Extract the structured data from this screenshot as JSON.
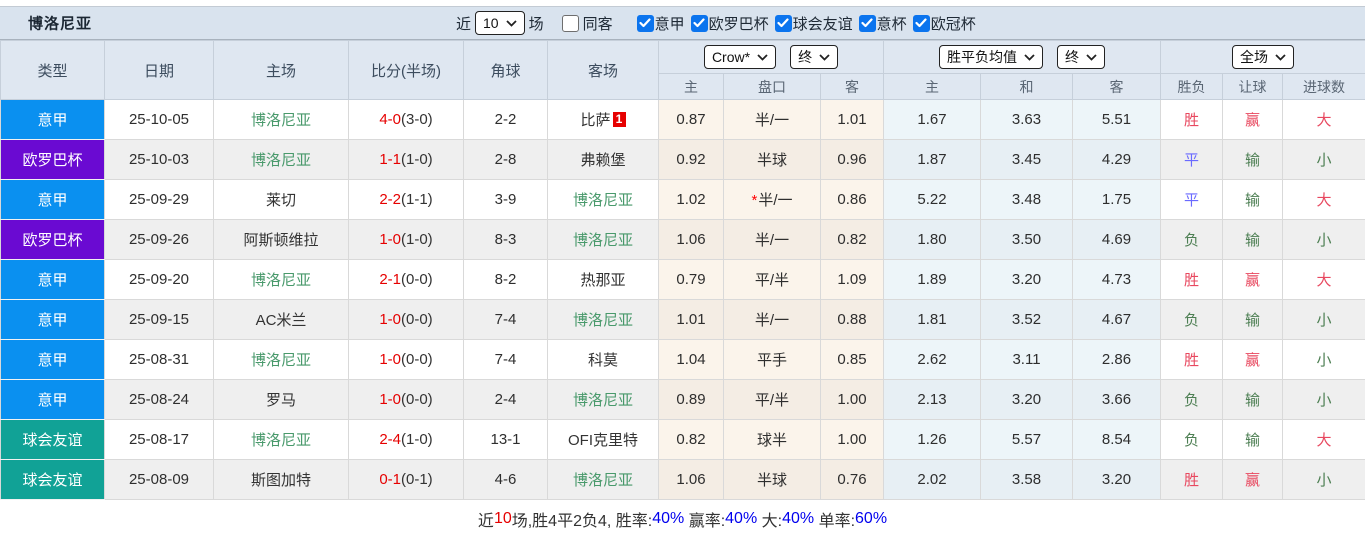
{
  "page_title": "博洛尼亚",
  "topbar": {
    "recent_label": "近",
    "recent_value": "10",
    "matches_label": "场",
    "same_away": {
      "label": "同客",
      "checked": false
    },
    "filters": [
      {
        "label": "意甲",
        "checked": true
      },
      {
        "label": "欧罗巴杯",
        "checked": true
      },
      {
        "label": "球会友谊",
        "checked": true
      },
      {
        "label": "意杯",
        "checked": true
      },
      {
        "label": "欧冠杯",
        "checked": true
      }
    ]
  },
  "header": {
    "columns": [
      "类型",
      "日期",
      "主场",
      "比分(半场)",
      "角球",
      "客场"
    ],
    "group_crow": {
      "company_select": "Crow*",
      "time_select": "终",
      "subcols": [
        "主",
        "盘口",
        "客"
      ]
    },
    "group_avg": {
      "company_select": "胜平负均值",
      "time_select": "终",
      "subcols": [
        "主",
        "和",
        "客"
      ]
    },
    "group_result": {
      "scope_select": "全场",
      "subcols": [
        "胜负",
        "让球",
        "进球数"
      ]
    }
  },
  "colors": {
    "league": {
      "意甲": "#0a90f0",
      "欧罗巴杯": "#6a0ad2",
      "球会友谊": "#11a296"
    },
    "result": {
      "胜": "#e8485f",
      "平": "#6a6aff",
      "负": "#4d7f53",
      "赢": "#e8485f",
      "输": "#4d7f53",
      "大": "#e8485f",
      "小": "#4d7f53"
    },
    "team_self": "#48996b",
    "team_other": "#333333",
    "score": "#e60000"
  },
  "rows": [
    {
      "league": "意甲",
      "date": "25-10-05",
      "home": "博洛尼亚",
      "home_self": true,
      "score": "4-0",
      "half_score": "(3-0)",
      "corners": "2-2",
      "away": "比萨",
      "away_self": false,
      "away_card": "1",
      "crow_home": "0.87",
      "handicap_star": "",
      "handicap": "半/一",
      "crow_away": "1.01",
      "avg_home": "1.67",
      "avg_draw": "3.63",
      "avg_away": "5.51",
      "result_wdl": "胜",
      "result_handicap": "赢",
      "result_goals": "大"
    },
    {
      "league": "欧罗巴杯",
      "date": "25-10-03",
      "home": "博洛尼亚",
      "home_self": true,
      "score": "1-1",
      "half_score": "(1-0)",
      "corners": "2-8",
      "away": "弗赖堡",
      "away_self": false,
      "away_card": "",
      "crow_home": "0.92",
      "handicap_star": "",
      "handicap": "半球",
      "crow_away": "0.96",
      "avg_home": "1.87",
      "avg_draw": "3.45",
      "avg_away": "4.29",
      "result_wdl": "平",
      "result_handicap": "输",
      "result_goals": "小"
    },
    {
      "league": "意甲",
      "date": "25-09-29",
      "home": "莱切",
      "home_self": false,
      "score": "2-2",
      "half_score": "(1-1)",
      "corners": "3-9",
      "away": "博洛尼亚",
      "away_self": true,
      "away_card": "",
      "crow_home": "1.02",
      "handicap_star": "*",
      "handicap": "半/一",
      "crow_away": "0.86",
      "avg_home": "5.22",
      "avg_draw": "3.48",
      "avg_away": "1.75",
      "result_wdl": "平",
      "result_handicap": "输",
      "result_goals": "大"
    },
    {
      "league": "欧罗巴杯",
      "date": "25-09-26",
      "home": "阿斯顿维拉",
      "home_self": false,
      "score": "1-0",
      "half_score": "(1-0)",
      "corners": "8-3",
      "away": "博洛尼亚",
      "away_self": true,
      "away_card": "",
      "crow_home": "1.06",
      "handicap_star": "",
      "handicap": "半/一",
      "crow_away": "0.82",
      "avg_home": "1.80",
      "avg_draw": "3.50",
      "avg_away": "4.69",
      "result_wdl": "负",
      "result_handicap": "输",
      "result_goals": "小"
    },
    {
      "league": "意甲",
      "date": "25-09-20",
      "home": "博洛尼亚",
      "home_self": true,
      "score": "2-1",
      "half_score": "(0-0)",
      "corners": "8-2",
      "away": "热那亚",
      "away_self": false,
      "away_card": "",
      "crow_home": "0.79",
      "handicap_star": "",
      "handicap": "平/半",
      "crow_away": "1.09",
      "avg_home": "1.89",
      "avg_draw": "3.20",
      "avg_away": "4.73",
      "result_wdl": "胜",
      "result_handicap": "赢",
      "result_goals": "大"
    },
    {
      "league": "意甲",
      "date": "25-09-15",
      "home": "AC米兰",
      "home_self": false,
      "score": "1-0",
      "half_score": "(0-0)",
      "corners": "7-4",
      "away": "博洛尼亚",
      "away_self": true,
      "away_card": "",
      "crow_home": "1.01",
      "handicap_star": "",
      "handicap": "半/一",
      "crow_away": "0.88",
      "avg_home": "1.81",
      "avg_draw": "3.52",
      "avg_away": "4.67",
      "result_wdl": "负",
      "result_handicap": "输",
      "result_goals": "小"
    },
    {
      "league": "意甲",
      "date": "25-08-31",
      "home": "博洛尼亚",
      "home_self": true,
      "score": "1-0",
      "half_score": "(0-0)",
      "corners": "7-4",
      "away": "科莫",
      "away_self": false,
      "away_card": "",
      "crow_home": "1.04",
      "handicap_star": "",
      "handicap": "平手",
      "crow_away": "0.85",
      "avg_home": "2.62",
      "avg_draw": "3.11",
      "avg_away": "2.86",
      "result_wdl": "胜",
      "result_handicap": "赢",
      "result_goals": "小"
    },
    {
      "league": "意甲",
      "date": "25-08-24",
      "home": "罗马",
      "home_self": false,
      "score": "1-0",
      "half_score": "(0-0)",
      "corners": "2-4",
      "away": "博洛尼亚",
      "away_self": true,
      "away_card": "",
      "crow_home": "0.89",
      "handicap_star": "",
      "handicap": "平/半",
      "crow_away": "1.00",
      "avg_home": "2.13",
      "avg_draw": "3.20",
      "avg_away": "3.66",
      "result_wdl": "负",
      "result_handicap": "输",
      "result_goals": "小"
    },
    {
      "league": "球会友谊",
      "date": "25-08-17",
      "home": "博洛尼亚",
      "home_self": true,
      "score": "2-4",
      "half_score": "(1-0)",
      "corners": "13-1",
      "away": "OFI克里特",
      "away_self": false,
      "away_card": "",
      "crow_home": "0.82",
      "handicap_star": "",
      "handicap": "球半",
      "crow_away": "1.00",
      "avg_home": "1.26",
      "avg_draw": "5.57",
      "avg_away": "8.54",
      "result_wdl": "负",
      "result_handicap": "输",
      "result_goals": "大"
    },
    {
      "league": "球会友谊",
      "date": "25-08-09",
      "home": "斯图加特",
      "home_self": false,
      "score": "0-1",
      "half_score": "(0-1)",
      "corners": "4-6",
      "away": "博洛尼亚",
      "away_self": true,
      "away_card": "",
      "crow_home": "1.06",
      "handicap_star": "",
      "handicap": "半球",
      "crow_away": "0.76",
      "avg_home": "2.02",
      "avg_draw": "3.58",
      "avg_away": "3.20",
      "result_wdl": "胜",
      "result_handicap": "赢",
      "result_goals": "小"
    }
  ],
  "footer": {
    "segments": [
      {
        "text": "近",
        "color": "#333333"
      },
      {
        "text": "10",
        "color": "#e60000"
      },
      {
        "text": "场,胜4平2负4, 胜率:",
        "color": "#333333"
      },
      {
        "text": "40%",
        "color": "#0000ee"
      },
      {
        "text": " 赢率:",
        "color": "#333333"
      },
      {
        "text": "40%",
        "color": "#0000ee"
      },
      {
        "text": " 大:",
        "color": "#333333"
      },
      {
        "text": "40%",
        "color": "#0000ee"
      },
      {
        "text": " 单率:",
        "color": "#333333"
      },
      {
        "text": "60%",
        "color": "#0000ee"
      }
    ]
  }
}
